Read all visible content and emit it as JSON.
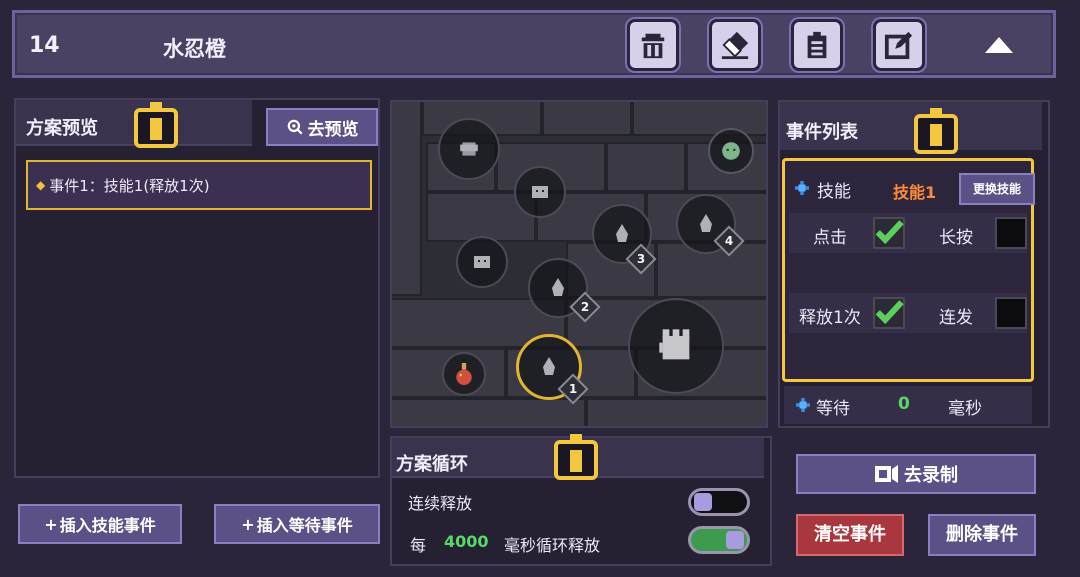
{
  "header": {
    "plan_number": "14",
    "plan_name": "水忍橙",
    "buttons": [
      "delete-icon",
      "eraser-icon",
      "clipboard-icon",
      "edit-icon"
    ],
    "collapse_icon": "triangle-up-icon"
  },
  "preview_panel": {
    "title": "方案预览",
    "preview_button": "去预览",
    "events": [
      {
        "label": "事件1：技能1(释放1次)"
      }
    ]
  },
  "insert_buttons": {
    "skill_event": "插入技能事件",
    "wait_event": "插入等待事件"
  },
  "map": {
    "slots": [
      {
        "number": "1"
      },
      {
        "number": "2"
      },
      {
        "number": "3"
      },
      {
        "number": "4"
      }
    ]
  },
  "event_list": {
    "title": "事件列表",
    "skill": {
      "label": "技能",
      "value": "技能1",
      "swap_button": "更换技能"
    },
    "options": {
      "click": {
        "label": "点击",
        "checked": true
      },
      "long_press": {
        "label": "长按",
        "checked": false
      },
      "release_once": {
        "label": "释放1次",
        "checked": true
      },
      "burst": {
        "label": "连发",
        "checked": false
      }
    },
    "wait": {
      "label": "等待",
      "value": "0",
      "unit": "毫秒"
    }
  },
  "loop_panel": {
    "title": "方案循环",
    "continuous": {
      "label": "连续释放",
      "enabled": false
    },
    "interval": {
      "prefix": "每",
      "value": "4000",
      "suffix": "毫秒循环释放",
      "enabled": true
    }
  },
  "actions": {
    "record": "去录制",
    "clear": "清空事件",
    "delete": "删除事件"
  },
  "colors": {
    "accent_yellow": "#f3c840",
    "skill_orange": "#ff8a3a",
    "value_green": "#59d96a",
    "button_purple": "#5b5187",
    "clear_red": "#a8373e"
  }
}
